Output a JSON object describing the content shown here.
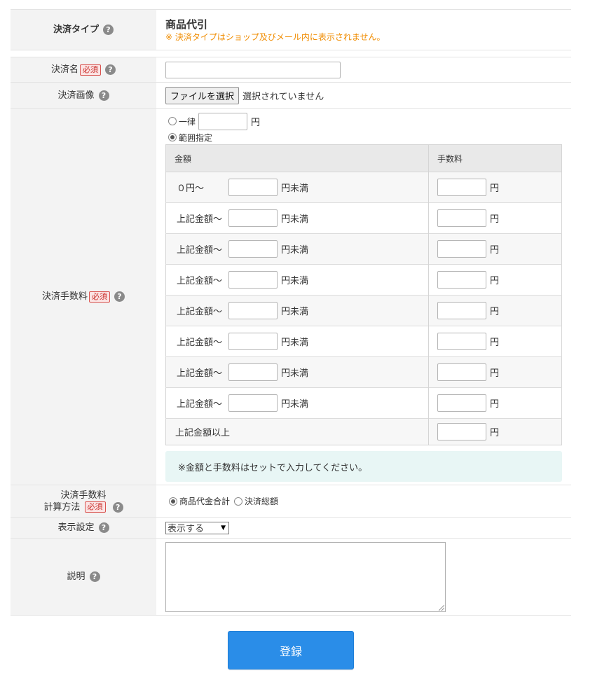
{
  "help_glyph": "?",
  "required_label": "必須",
  "payment_type": {
    "label": "決済タイプ",
    "value": "商品代引",
    "note": "※ 決済タイプはショップ及びメール内に表示されません。",
    "note_color": "#f08c00"
  },
  "payment_name": {
    "label": "決済名",
    "value": ""
  },
  "payment_image": {
    "label": "決済画像",
    "button": "ファイルを選択",
    "status": "選択されていません"
  },
  "fee": {
    "label": "決済手数料",
    "flat_option": "一律",
    "flat_unit": "円",
    "range_option": "範囲指定",
    "selected": "範囲指定",
    "col_amount": "金額",
    "col_fee": "手数料",
    "first_start": "０円～",
    "row_start": "上記金額～",
    "under_unit": "円未満",
    "fee_unit": "円",
    "last_row": "上記金額以上",
    "notice": "※金額と手数料はセットで入力してください。"
  },
  "calc": {
    "label_line1": "決済手数料",
    "label_line2": "計算方法",
    "option1": "商品代金合計",
    "option2": "決済総額",
    "selected": "商品代金合計"
  },
  "display": {
    "label": "表示設定",
    "selected": "表示する"
  },
  "description": {
    "label": "説明",
    "value": ""
  },
  "submit": {
    "label": "登録",
    "color": "#2a8de8"
  }
}
